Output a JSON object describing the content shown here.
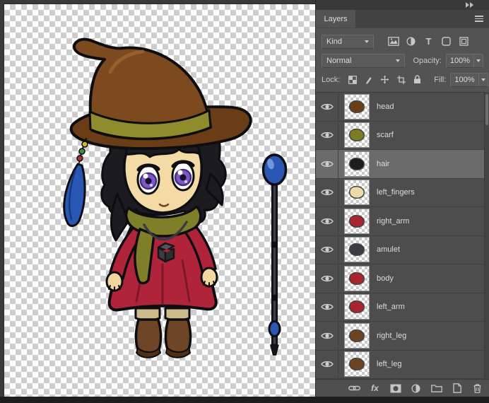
{
  "panel": {
    "tab_label": "Layers",
    "filter": {
      "kind_label": "Kind"
    },
    "blend": {
      "mode": "Normal",
      "opacity_label": "Opacity:",
      "opacity_value": "100%"
    },
    "lock": {
      "label": "Lock:",
      "fill_label": "Fill:",
      "fill_value": "100%"
    },
    "glyphs": {
      "type": "T",
      "fx": "fx"
    },
    "filter_icons": [
      "pixel-layer-filter",
      "adjustment-layer-filter",
      "type-layer-filter",
      "shape-layer-filter",
      "smart-object-filter"
    ],
    "lock_icons": [
      "lock-transparent-pixels",
      "lock-image-pixels",
      "lock-position",
      "lock-artboard-nesting",
      "lock-all"
    ],
    "bottom_icons": [
      "link-layers",
      "layer-effects",
      "add-layer-mask",
      "new-adjustment-layer",
      "new-group",
      "new-layer",
      "delete-layer"
    ],
    "layers": [
      {
        "name": "head",
        "thumb_color": "#6b3f16"
      },
      {
        "name": "scarf",
        "thumb_color": "#7c7c24"
      },
      {
        "name": "hair",
        "thumb_color": "#1d1d1f",
        "selected": true
      },
      {
        "name": "left_fingers",
        "thumb_color": "#eed9a8"
      },
      {
        "name": "right_arm",
        "thumb_color": "#a8242f"
      },
      {
        "name": "amulet",
        "thumb_color": "#3c3c44"
      },
      {
        "name": "body",
        "thumb_color": "#a8242f"
      },
      {
        "name": "left_arm",
        "thumb_color": "#a8242f"
      },
      {
        "name": "right_leg",
        "thumb_color": "#6b4423"
      },
      {
        "name": "left_leg",
        "thumb_color": "#6b4423"
      }
    ]
  },
  "artwork": {
    "character": "chibi witch girl with brown hat, purple eyes, red dress, green scarf, amulet, brown boots",
    "prop": "blue orb staff",
    "colors": {
      "hat": "#7c4a1e",
      "band": "#8e8c2c",
      "dress": "#b02439",
      "scarf": "#7f7f2a",
      "skin": "#f4daa4",
      "eyes": "#7e57c8",
      "hair": "#1b1b20",
      "orb": "#2a57b4",
      "boots": "#6e4526"
    }
  }
}
